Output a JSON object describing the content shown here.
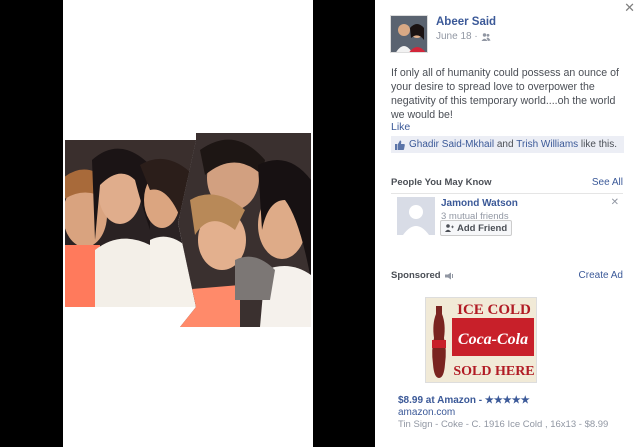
{
  "post": {
    "author": "Abeer Said",
    "date": "June 18 ·",
    "privacy_icon": "friends-icon",
    "text": "If only all of humanity could possess an ounce of your desire to spread love to overpower the negativity of this temporary world....oh the world we would be!",
    "like_label": "Like",
    "liker_1": "Ghadir Said-Mkhail",
    "likes_and": " and ",
    "liker_2": "Trish Williams",
    "likes_suffix": " like this."
  },
  "pymk": {
    "title": "People You May Know",
    "see_all": "See All",
    "person_name": "Jamond Watson",
    "mutual": "3 mutual friends",
    "add_friend": "Add Friend"
  },
  "sponsored": {
    "title": "Sponsored",
    "create_ad": "Create Ad",
    "ad_title": "$8.99 at Amazon - ★★★★★",
    "domain": "amazon.com",
    "description": "Tin Sign - Coke - C. 1916 Ice Cold , 16x13 - $8.99",
    "sign_top": "ICE COLD",
    "sign_brand": "Coca-Cola",
    "sign_bottom": "SOLD HERE"
  },
  "colors": {
    "link": "#3b5998",
    "sign_red": "#c8202a"
  }
}
